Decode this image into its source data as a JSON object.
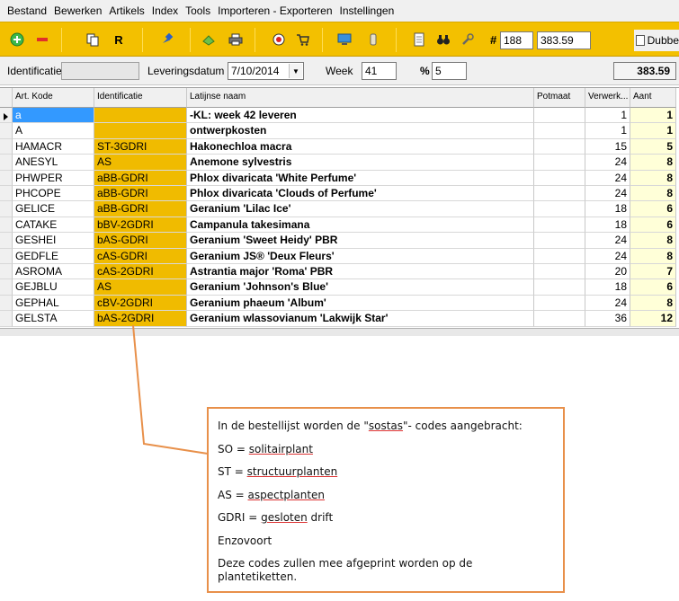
{
  "menu": [
    "Bestand",
    "Bewerken",
    "Artikels",
    "Index",
    "Tools",
    "Importeren - Exporteren",
    "Instellingen"
  ],
  "toolbar": {
    "r_label": "R",
    "hash": "#",
    "count": "188",
    "amount": "383.59",
    "dubbel_label": "Dubbe"
  },
  "header": {
    "identificatie_label": "Identificatie",
    "identificatie_value": "",
    "leveringsdatum_label": "Leveringsdatum",
    "leveringsdatum_value": "7/10/2014",
    "week_label": "Week",
    "week_value": "41",
    "percent_label": "%",
    "percent_value": "5",
    "total": "383.59"
  },
  "table": {
    "columns": [
      "Art. Kode",
      "Identificatie",
      "Latijnse naam",
      "Potmaat",
      "Verwerk...",
      "Aant"
    ],
    "rows": [
      {
        "kode": "a",
        "id": "",
        "lat": "-KL: week 42 leveren",
        "pot": "",
        "verw": "1",
        "aant": "1"
      },
      {
        "kode": "A",
        "id": "",
        "lat": "ontwerpkosten",
        "pot": "",
        "verw": "1",
        "aant": "1"
      },
      {
        "kode": "HAMACR",
        "id": "ST-3GDRI",
        "lat": "Hakonechloa macra",
        "pot": "",
        "verw": "15",
        "aant": "5"
      },
      {
        "kode": "ANESYL",
        "id": "AS",
        "lat": "Anemone sylvestris",
        "pot": "",
        "verw": "24",
        "aant": "8"
      },
      {
        "kode": "PHWPER",
        "id": "aBB-GDRI",
        "lat": "Phlox divaricata 'White Perfume'",
        "pot": "",
        "verw": "24",
        "aant": "8"
      },
      {
        "kode": "PHCOPE",
        "id": "aBB-GDRI",
        "lat": "Phlox divaricata 'Clouds of Perfume'",
        "pot": "",
        "verw": "24",
        "aant": "8"
      },
      {
        "kode": "GELICE",
        "id": "aBB-GDRI",
        "lat": "Geranium 'Lilac Ice'",
        "pot": "",
        "verw": "18",
        "aant": "6"
      },
      {
        "kode": "CATAKE",
        "id": "bBV-2GDRI",
        "lat": "Campanula takesimana",
        "pot": "",
        "verw": "18",
        "aant": "6"
      },
      {
        "kode": "GESHEI",
        "id": "bAS-GDRI",
        "lat": "Geranium 'Sweet Heidy' PBR",
        "pot": "",
        "verw": "24",
        "aant": "8"
      },
      {
        "kode": "GEDFLE",
        "id": "cAS-GDRI",
        "lat": "Geranium JS® 'Deux Fleurs'",
        "pot": "",
        "verw": "24",
        "aant": "8"
      },
      {
        "kode": "ASROMA",
        "id": "cAS-2GDRI",
        "lat": "Astrantia major 'Roma' PBR",
        "pot": "",
        "verw": "20",
        "aant": "7"
      },
      {
        "kode": "GEJBLU",
        "id": "AS",
        "lat": "Geranium 'Johnson's Blue'",
        "pot": "",
        "verw": "18",
        "aant": "6"
      },
      {
        "kode": "GEPHAL",
        "id": "cBV-2GDRI",
        "lat": "Geranium phaeum 'Album'",
        "pot": "",
        "verw": "24",
        "aant": "8"
      },
      {
        "kode": "GELSTA",
        "id": "bAS-2GDRI",
        "lat": "Geranium wlassovianum 'Lakwijk Star'",
        "pot": "",
        "verw": "36",
        "aant": "12"
      }
    ]
  },
  "callout": {
    "line1_pre": "In de bestellijst worden de \"",
    "line1_word": "sostas",
    "line1_post": "\"- codes aangebracht:",
    "so_pre": "SO = ",
    "so_word": "solitairplant",
    "st_pre": "ST = ",
    "st_word": "structuurplanten",
    "as_pre": "AS = ",
    "as_word": "aspectplanten",
    "gdri_pre": "GDRI = ",
    "gdri_word": "gesloten",
    "gdri_post": " drift",
    "enzovoort": "Enzovoort",
    "last": "Deze codes zullen mee afgeprint worden op de plantetiketten."
  }
}
